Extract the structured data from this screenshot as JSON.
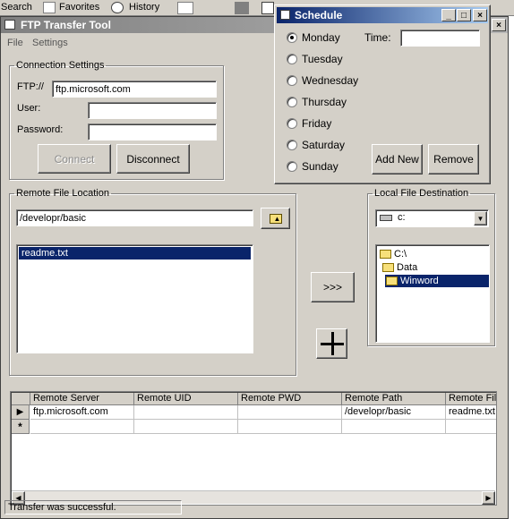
{
  "ie_toolbar": {
    "search": "Search",
    "favorites": "Favorites",
    "history": "History"
  },
  "main": {
    "title": "FTP Transfer Tool",
    "menu": [
      "File",
      "Settings"
    ],
    "connection": {
      "legend": "Connection Settings",
      "ftp_label": "FTP://",
      "ftp_value": "ftp.microsoft.com",
      "user_label": "User:",
      "user_value": "",
      "password_label": "Password:",
      "password_value": "",
      "connect": "Connect",
      "disconnect": "Disconnect"
    },
    "remote": {
      "legend": "Remote File Location",
      "path": "/developr/basic",
      "files": [
        "readme.txt"
      ]
    },
    "transfer_button": ">>>",
    "local": {
      "legend": "Local File Destination",
      "drive": "c:",
      "folders": [
        "C:\\",
        "Data",
        "Winword"
      ]
    },
    "grid": {
      "columns": [
        "Remote Server",
        "Remote UID",
        "Remote PWD",
        "Remote Path",
        "Remote File"
      ],
      "rows": [
        [
          "ftp.microsoft.com",
          "",
          "",
          "/developr/basic",
          "readme.txt"
        ]
      ],
      "new_row_marker": "*",
      "current_row_marker": "▶"
    },
    "status": "Transfer was successful."
  },
  "schedule": {
    "title": "Schedule",
    "days": [
      "Monday",
      "Tuesday",
      "Wednesday",
      "Thursday",
      "Friday",
      "Saturday",
      "Sunday"
    ],
    "selected_day": "Monday",
    "time_label": "Time:",
    "time_value": "",
    "add_new": "Add New",
    "remove": "Remove"
  }
}
